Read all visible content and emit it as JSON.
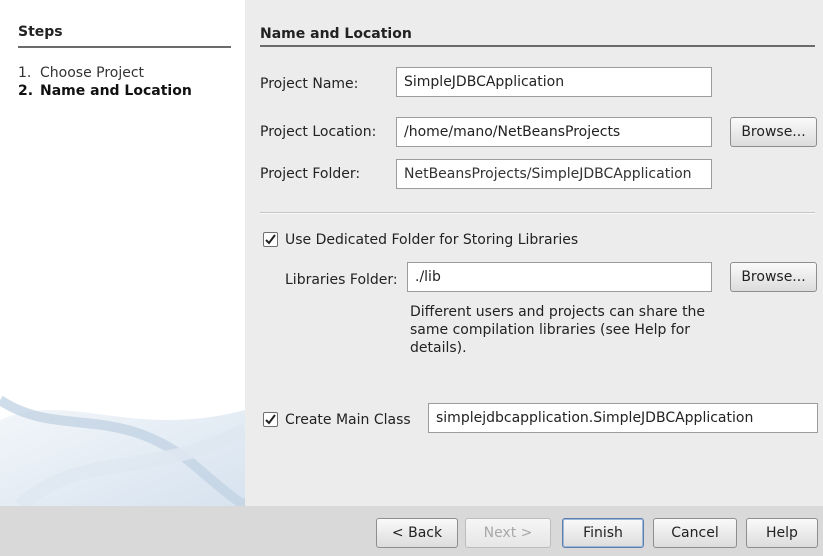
{
  "sidebar": {
    "title": "Steps",
    "steps": [
      {
        "num": "1.",
        "label": "Choose Project"
      },
      {
        "num": "2.",
        "label": "Name and Location"
      }
    ]
  },
  "main": {
    "title": "Name and Location",
    "project_name": {
      "label": "Project Name:",
      "mnemonic": "N",
      "value": "SimpleJDBCApplication"
    },
    "project_location": {
      "label": "Project Location:",
      "value": "/home/mano/NetBeansProjects",
      "browse_label": "Browse..."
    },
    "project_folder": {
      "label": "Project Folder:",
      "value": "NetBeansProjects/SimpleJDBCApplication"
    },
    "dedicated_folder": {
      "label": "Use Dedicated Folder for Storing Libraries",
      "checked": true
    },
    "libraries_folder": {
      "label": "Libraries Folder:",
      "value": "./lib",
      "browse_label": "Browse..."
    },
    "libraries_note": "Different users and projects can share the same compilation libraries (see Help for details).",
    "create_main_class": {
      "label": "Create Main Class",
      "checked": true,
      "value": "simplejdbcapplication.SimpleJDBCApplication"
    }
  },
  "footer": {
    "back_label": "< Back",
    "next_label": "Next >",
    "finish_label": "Finish",
    "cancel_label": "Cancel",
    "help_label": "Help"
  },
  "colors": {
    "panel_bg": "#ececec",
    "sidebar_bg": "#ffffff",
    "footer_bg": "#d9d9d9",
    "rule": "#6b6b6b",
    "default_button_border": "#5a7fae"
  }
}
